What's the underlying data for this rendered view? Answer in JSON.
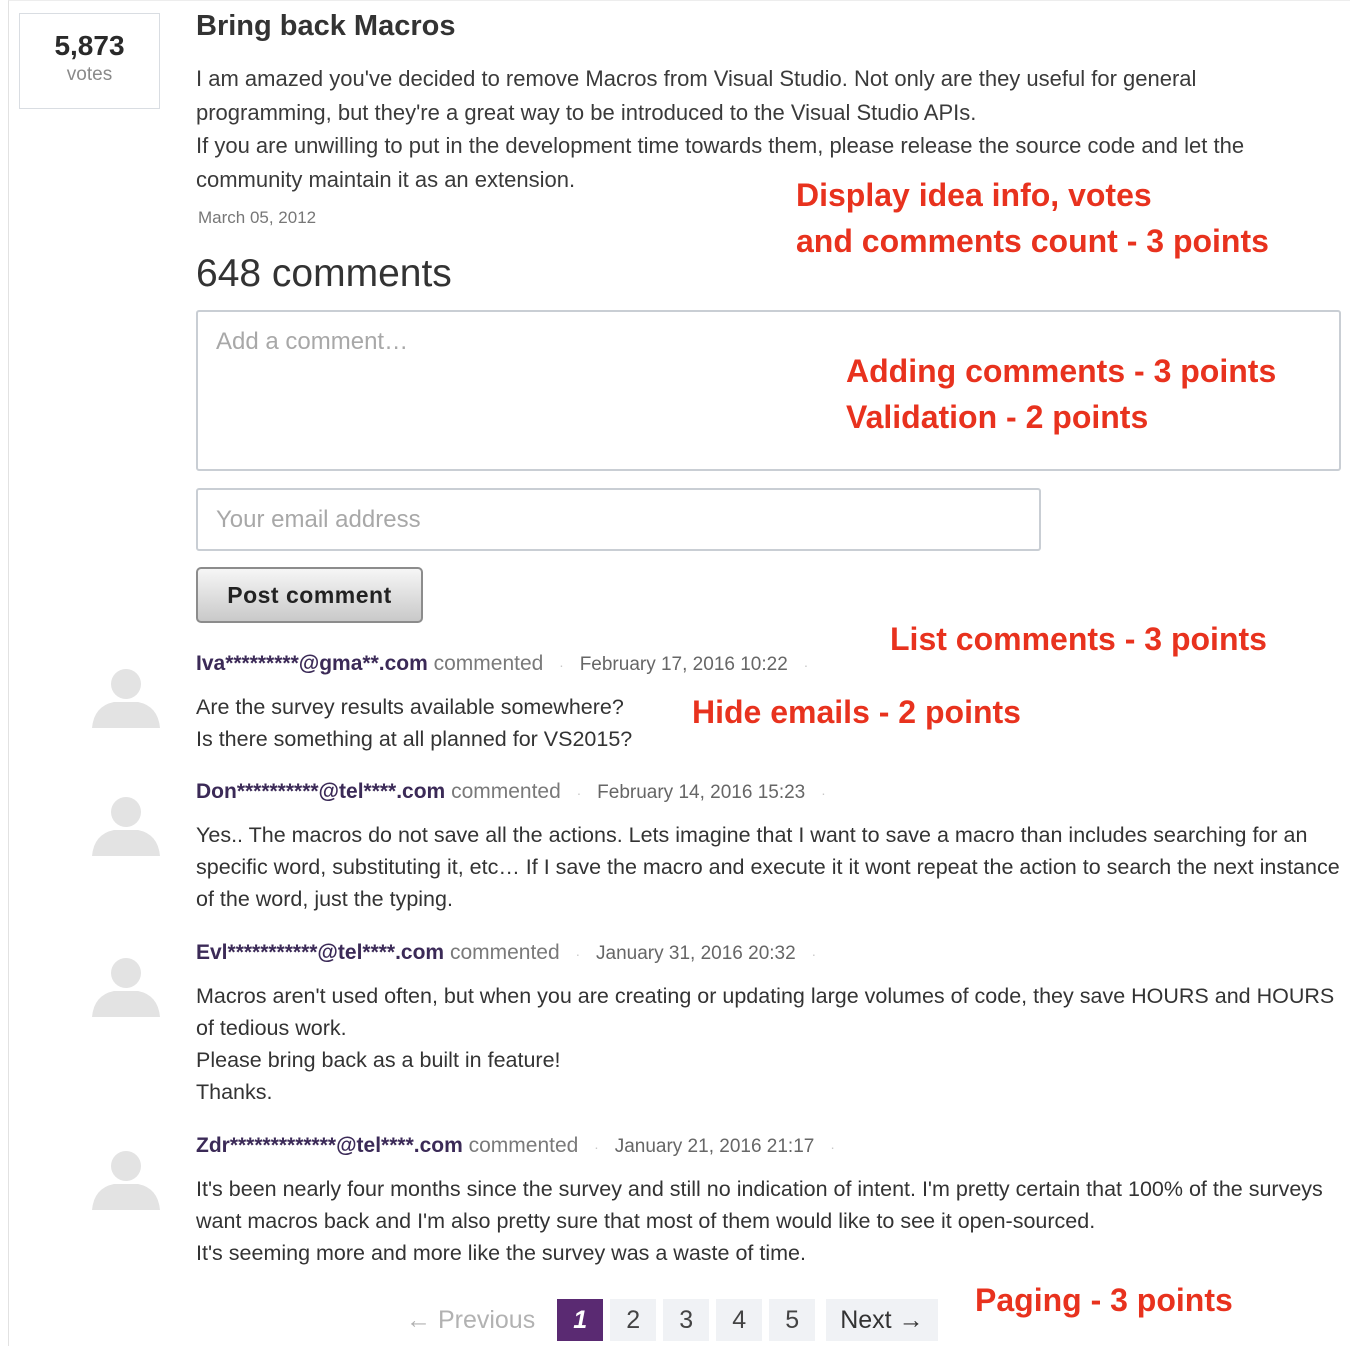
{
  "idea": {
    "votes": "5,873",
    "votes_label": "votes",
    "title": "Bring back Macros",
    "body": [
      "I am amazed you've decided to remove Macros from Visual Studio. Not only are they useful for general programming, but they're a great way to be introduced to the Visual Studio APIs.",
      "If you are unwilling to put in the development time towards them, please release the source code and let the community maintain it as an extension."
    ],
    "date": "March 05, 2012"
  },
  "comments_heading": "648 comments",
  "form": {
    "comment_placeholder": "Add a comment…",
    "email_placeholder": "Your email address",
    "submit_label": "Post comment"
  },
  "comment_verb": "commented",
  "comments": [
    {
      "author": "Iva*********@gma**.com",
      "date": "February 17, 2016 10:22",
      "text": [
        "Are the survey results available somewhere?",
        "Is there something at all planned for VS2015?"
      ]
    },
    {
      "author": "Don**********@tel****.com",
      "date": "February 14, 2016 15:23",
      "text": [
        "Yes.. The macros do not save all the actions. Lets imagine that I want to save a macro than includes searching for an specific word, substituting it, etc… If I save the macro and execute it it wont repeat the action to search the next instance of the word, just the typing."
      ]
    },
    {
      "author": "Evl***********@tel****.com",
      "date": "January 31, 2016 20:32",
      "text": [
        "Macros aren't used often, but when you are creating or updating large volumes of code, they save HOURS and HOURS of tedious work.",
        "Please bring back as a built in feature!",
        "Thanks."
      ]
    },
    {
      "author": "Zdr*************@tel****.com",
      "date": "January 21, 2016 21:17",
      "text": [
        "It's been nearly four months since the survey and still no indication of intent. I'm pretty certain that 100% of the surveys want macros back and I'm also pretty sure that most of them would like to see it open-sourced.",
        "It's seeming more and more like the survey was a waste of time."
      ]
    }
  ],
  "pagination": {
    "previous": "← Previous",
    "pages": [
      "1",
      "2",
      "3",
      "4",
      "5"
    ],
    "current": "1",
    "next": "Next →"
  },
  "annotations": {
    "idea_info_line1": "Display idea info, votes",
    "idea_info_line2": "and comments count - 3 points",
    "adding_comments": "Adding comments - 3 points",
    "validation": "Validation - 2 points",
    "list_comments": "List comments - 3 points",
    "hide_emails": "Hide emails - 2 points",
    "paging": "Paging - 3 points"
  },
  "colors": {
    "annotation": "#e8321e",
    "author": "#3b2a57",
    "active_page": "#5a2a72"
  }
}
